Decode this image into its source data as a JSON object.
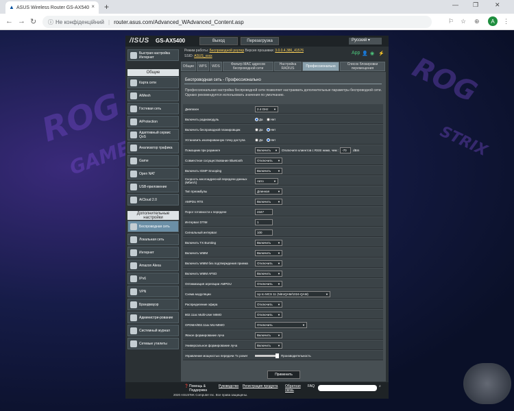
{
  "browser": {
    "tab_title": "ASUS Wireless Router GS-AX540",
    "favicon": "asus-logo-icon",
    "security_label": "Не конфіденційний",
    "url": "router.asus.com/Advanced_WAdvanced_Content.asp",
    "avatar_letter": "A",
    "new_tab": "+",
    "close": "×",
    "win_min": "—",
    "win_max": "❐",
    "win_close": "✕"
  },
  "router": {
    "brand": "/ISUS",
    "model": "GS-AX5400",
    "logout_label": "Выход",
    "reboot_label": "Перезагрузка",
    "language": "Русский",
    "mode_label": "Режим работы:",
    "mode_value": "Беспроводной роутер",
    "firmware_label": "Версия прошивки:",
    "firmware_value": "3.0.0.4.386_41576",
    "ssid_label": "SSID:",
    "ssid_value": "ASUS_xxxx",
    "app_label": "App"
  },
  "sidebar": {
    "quick_setup": "Быстрая настройка Интернет",
    "general_header": "Общие",
    "general_items": [
      {
        "label": "Карта сети",
        "icon": "network-map-icon"
      },
      {
        "label": "AiMesh",
        "icon": "aimesh-icon"
      },
      {
        "label": "Гостевая сеть",
        "icon": "guest-network-icon"
      },
      {
        "label": "AiProtection",
        "icon": "shield-icon"
      },
      {
        "label": "Адаптивный сервис QoS",
        "icon": "qos-icon"
      },
      {
        "label": "Анализатор трафика",
        "icon": "traffic-analyzer-icon"
      },
      {
        "label": "Game",
        "icon": "gamepad-icon"
      },
      {
        "label": "Open NAT",
        "icon": "open-nat-icon"
      },
      {
        "label": "USB-приложение",
        "icon": "usb-icon"
      },
      {
        "label": "AiCloud 2.0",
        "icon": "cloud-icon"
      }
    ],
    "advanced_header": "Дополнительные настройки",
    "advanced_items": [
      {
        "label": "Беспроводная сеть",
        "icon": "wifi-icon"
      },
      {
        "label": "Локальная сеть",
        "icon": "lan-icon"
      },
      {
        "label": "Интернет",
        "icon": "globe-icon"
      },
      {
        "label": "Amazon Alexa",
        "icon": "alexa-icon"
      },
      {
        "label": "IPv6",
        "icon": "ipv6-icon"
      },
      {
        "label": "VPN",
        "icon": "vpn-icon"
      },
      {
        "label": "Брандмауэр",
        "icon": "firewall-icon"
      },
      {
        "label": "Администри-рование",
        "icon": "admin-icon"
      },
      {
        "label": "Системный журнал",
        "icon": "log-icon"
      },
      {
        "label": "Сетевые утилиты",
        "icon": "tools-icon"
      }
    ]
  },
  "tabs": [
    {
      "label": "Общие"
    },
    {
      "label": "WPS"
    },
    {
      "label": "WDS"
    },
    {
      "label": "Фильтр MAC адресов беспроводной сети"
    },
    {
      "label": "Настройка RADIUS"
    },
    {
      "label": "Профессионально"
    },
    {
      "label": "Список блокировки перемещения"
    }
  ],
  "content": {
    "title": "Беспроводная сеть - Профессионально",
    "description": "Профессиональная настройка беспроводной сети позволяет настраивать дополнительные параметры беспроводной сети. Однако рекомендуется использовать значения по умолчанию.",
    "yes": "Да",
    "no": "Нет",
    "rows": [
      {
        "label": "Диапазон",
        "value": "2.4 GHz"
      },
      {
        "label": "Включить радиомодуль",
        "value": "Да"
      },
      {
        "label": "Включить беспроводной планировщик",
        "value": "Нет"
      },
      {
        "label": "Установить изолированную точку доступа",
        "value": "Нет"
      },
      {
        "label": "Помощник при роуминге",
        "value": "Включить",
        "extra_prefix": "Отключите клиентов с RSSI ниже, чем :",
        "extra_value": "-70",
        "extra_unit": "dBm"
      },
      {
        "label": "Совместное сосуществование Bluetooth",
        "value": "Отключить"
      },
      {
        "label": "Включить IGMP Snooping",
        "value": "Включить"
      },
      {
        "label": "Скорость многоадресной передачи данных (Мбит/с)",
        "value": "Авто"
      },
      {
        "label": "Тип преамбулы",
        "value": "Длинная"
      },
      {
        "label": "AMPDU RTS",
        "value": "Включить"
      },
      {
        "label": "Порог готовности к передаче",
        "value": "2347"
      },
      {
        "label": "Интервал DTIM",
        "value": "1"
      },
      {
        "label": "Сигнальный интервал",
        "value": "100"
      },
      {
        "label": "Включить TX Bursting",
        "value": "Включить"
      },
      {
        "label": "Включить WMM",
        "value": "Включить"
      },
      {
        "label": "Включить WMM без подтверждения приема",
        "value": "Отключить"
      },
      {
        "label": "Включить WMM APSD",
        "value": "Включить"
      },
      {
        "label": "Оптимизация агрегации AMPDU",
        "value": "Отключить"
      },
      {
        "label": "Схема модуляции",
        "value": "Up to MCS 11 (NitroQAM/1024-QAM)"
      },
      {
        "label": "Распределение эфира",
        "value": "Отключить"
      },
      {
        "label": "802.11ac Multi-User MIMO",
        "value": "Отключить"
      },
      {
        "label": "OFDMA/802.11ax MU-MIMO",
        "value": "Отключить"
      },
      {
        "label": "Явное формирование луча",
        "value": "Включить"
      },
      {
        "label": "Универсальное формирование луча",
        "value": "Включить"
      },
      {
        "label": "Управление мощностью передачи Tx power",
        "value": "Производительность",
        "slider_level": 1.0
      }
    ],
    "apply_label": "Применить"
  },
  "footer": {
    "help_label": "Помощь & Поддержка",
    "links": [
      "Руководство",
      "Регистрация продукта",
      "Обратная связь"
    ],
    "faq_label": "FAQ",
    "copyright": "2020 ASUSTeK Computer Inc. Все права защищены."
  }
}
